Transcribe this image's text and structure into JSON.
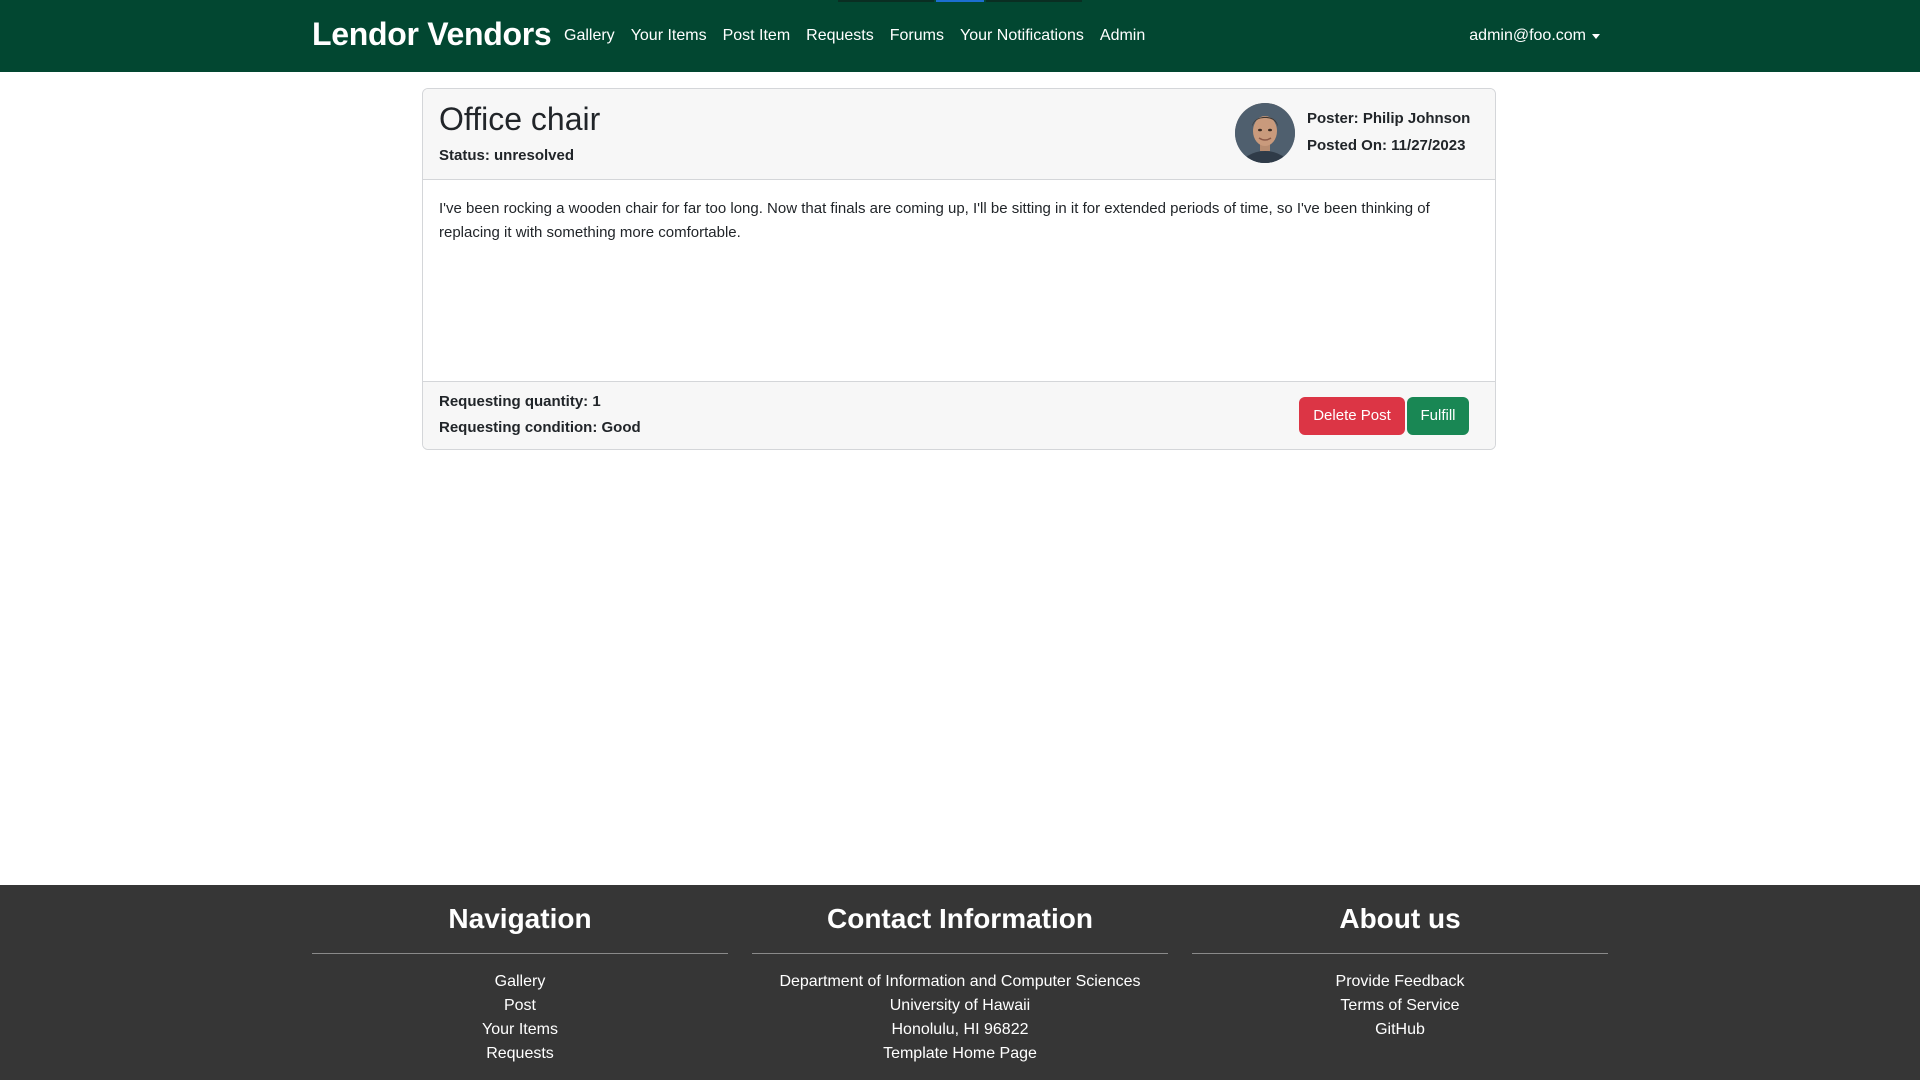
{
  "navbar": {
    "brand": "Lendor Vendors",
    "links": [
      "Gallery",
      "Your Items",
      "Post Item",
      "Requests",
      "Forums",
      "Your Notifications",
      "Admin"
    ],
    "user": "admin@foo.com",
    "background_color": "#024731"
  },
  "post": {
    "title": "Office chair",
    "status": "Status: unresolved",
    "poster": "Poster: Philip Johnson",
    "posted_on": "Posted On: 11/27/2023",
    "body": "I've been rocking a wooden chair for far too long. Now that finals are coming up, I'll be sitting in it for extended periods of time, so I've been thinking of replacing it with something more comfortable.",
    "requesting_quantity": "Requesting quantity: 1",
    "requesting_condition": "Requesting condition: Good",
    "delete_label": "Delete Post",
    "fulfill_label": "Fulfill",
    "delete_color": "#dc3545",
    "fulfill_color": "#198754"
  },
  "footer": {
    "background_color": "#363636",
    "navigation": {
      "heading": "Navigation",
      "items": [
        "Gallery",
        "Post",
        "Your Items",
        "Requests"
      ]
    },
    "contact": {
      "heading": "Contact Information",
      "lines": [
        "Department of Information and Computer Sciences",
        "University of Hawaii",
        "Honolulu, HI 96822",
        "Template Home Page"
      ]
    },
    "about": {
      "heading": "About us",
      "items": [
        "Provide Feedback",
        "Terms of Service",
        "GitHub"
      ]
    }
  }
}
